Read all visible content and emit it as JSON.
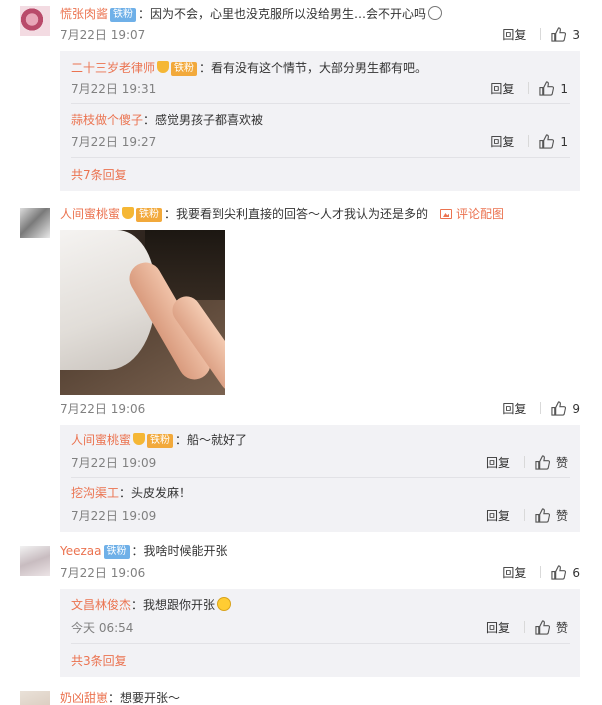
{
  "comments": [
    {
      "username": "慌张肉酱",
      "badge": "铁粉",
      "text": "：因为不会，心里也没克服所以没给男生",
      "text_tail": "…会不开心吗",
      "time": "7月22日 19:07",
      "reply_label": "回复",
      "likes": "3",
      "replies": [
        {
          "username": "二十三岁老律师",
          "badge": "铁粉",
          "text": "：看有没有这个情节，大部分男生都有吧。",
          "time": "7月22日 19:31",
          "reply_label": "回复",
          "likes": "1"
        },
        {
          "username": "蒜枝做个傻子",
          "text": "：感觉男孩子都喜欢被",
          "time": "7月22日 19:27",
          "reply_label": "回复",
          "likes": "1"
        }
      ],
      "more_replies": "共7条回复"
    },
    {
      "username": "人间蜜桃蜜",
      "badge": "铁粉",
      "text": "：我要看到尖利直接的回答～人才我认为还是多的",
      "pic_link": "评论配图",
      "time": "7月22日 19:06",
      "reply_label": "回复",
      "likes": "9",
      "replies": [
        {
          "username": "人间蜜桃蜜",
          "badge": "铁粉",
          "text": "：船～就好了",
          "time": "7月22日 19:09",
          "reply_label": "回复",
          "likes": "赞"
        },
        {
          "username": "挖沟渠工",
          "text": "：头皮发麻！",
          "time": "7月22日 19:09",
          "reply_label": "回复",
          "likes": "赞"
        }
      ]
    },
    {
      "username": "Yeezaa",
      "badge": "铁粉",
      "text": "：我啥时候能开张",
      "time": "7月22日 19:06",
      "reply_label": "回复",
      "likes": "6",
      "replies": [
        {
          "username": "文昌林俊杰",
          "text": "：我想跟你开张",
          "time": "今天 06:54",
          "reply_label": "回复",
          "likes": "赞"
        }
      ],
      "more_replies": "共3条回复"
    },
    {
      "username": "奶凶甜崽",
      "text": "：想要开张～"
    }
  ]
}
